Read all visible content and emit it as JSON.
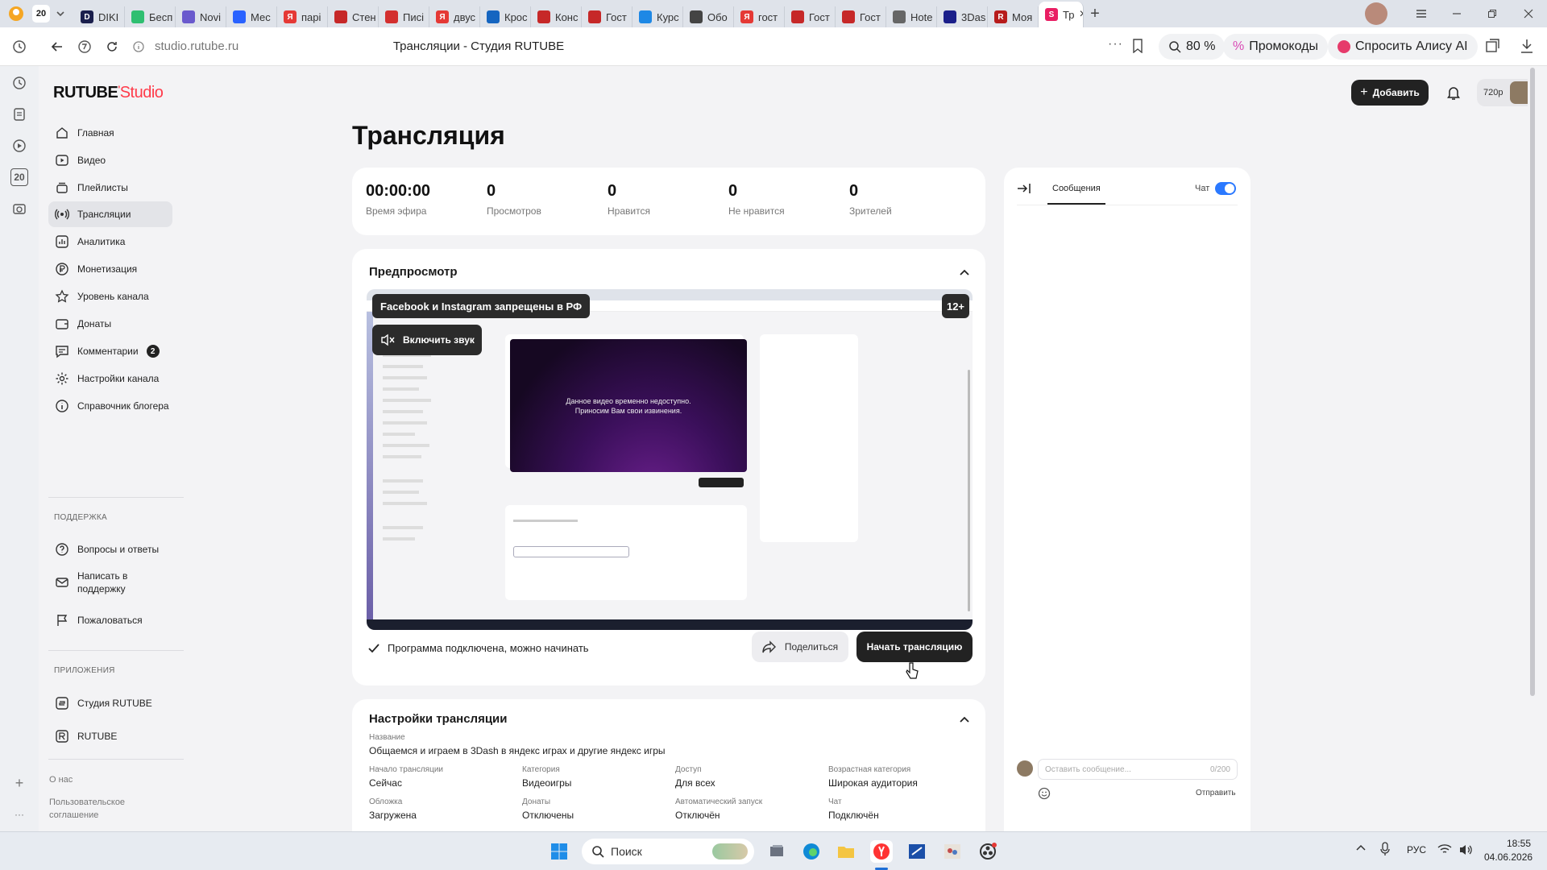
{
  "browser": {
    "tab_counter": "20",
    "tabs": [
      {
        "label": "DIKI",
        "color": "#1b1f4d",
        "letter": "D"
      },
      {
        "label": "Бесп",
        "color": "#2fbf71",
        "letter": ""
      },
      {
        "label": "Novi",
        "color": "#6a5acd",
        "letter": ""
      },
      {
        "label": "Мес",
        "color": "#2962ff",
        "letter": ""
      },
      {
        "label": "парі",
        "color": "#e53935",
        "letter": "Я"
      },
      {
        "label": "Стен",
        "color": "#c62828",
        "letter": ""
      },
      {
        "label": "Писі",
        "color": "#d32f2f",
        "letter": ""
      },
      {
        "label": "двус",
        "color": "#e53935",
        "letter": "Я"
      },
      {
        "label": "Крос",
        "color": "#1565c0",
        "letter": ""
      },
      {
        "label": "Конс",
        "color": "#c62828",
        "letter": ""
      },
      {
        "label": "Гост",
        "color": "#c62828",
        "letter": ""
      },
      {
        "label": "Курс",
        "color": "#1e88e5",
        "letter": ""
      },
      {
        "label": "Обо",
        "color": "#444444",
        "letter": ""
      },
      {
        "label": "гост",
        "color": "#e53935",
        "letter": "Я"
      },
      {
        "label": "Гост",
        "color": "#c62828",
        "letter": ""
      },
      {
        "label": "Гост",
        "color": "#c62828",
        "letter": ""
      },
      {
        "label": "Hote",
        "color": "#666666",
        "letter": ""
      },
      {
        "label": "3Das",
        "color": "#1b1f8a",
        "letter": ""
      },
      {
        "label": "Моя",
        "color": "#b71c1c",
        "letter": "R"
      },
      {
        "label": "Тр",
        "color": "#e91e63",
        "letter": "S"
      }
    ],
    "url": "studio.rutube.ru",
    "page_title": "Трансляции - Студия RUTUBE",
    "zoom": "80 %",
    "promo": "Промокоды",
    "alice": "Спросить Алису AI"
  },
  "header": {
    "logo_main": "RUTUBE",
    "logo_sub": "Studio",
    "add_button": "Добавить",
    "quality": "720p"
  },
  "sidebar": {
    "items": [
      {
        "label": "Главная",
        "icon": "home-icon"
      },
      {
        "label": "Видео",
        "icon": "video-icon"
      },
      {
        "label": "Плейлисты",
        "icon": "playlist-icon"
      },
      {
        "label": "Трансляции",
        "icon": "broadcast-icon"
      },
      {
        "label": "Аналитика",
        "icon": "analytics-icon"
      },
      {
        "label": "Монетизация",
        "icon": "ruble-icon"
      },
      {
        "label": "Уровень канала",
        "icon": "star-icon"
      },
      {
        "label": "Донаты",
        "icon": "wallet-icon"
      },
      {
        "label": "Комментарии",
        "icon": "comment-icon",
        "badge": "2"
      },
      {
        "label": "Настройки канала",
        "icon": "gear-icon"
      },
      {
        "label": "Справочник блогера",
        "icon": "info-icon"
      }
    ],
    "support_heading": "ПОДДЕРЖКА",
    "support_items": [
      {
        "label": "Вопросы и ответы",
        "icon": "question-icon"
      },
      {
        "label": "Написать в поддержку",
        "icon": "mail-icon"
      },
      {
        "label": "Пожаловаться",
        "icon": "flag-icon"
      }
    ],
    "apps_heading": "ПРИЛОЖЕНИЯ",
    "apps_items": [
      {
        "label": "Студия RUTUBE",
        "icon": "studio-app-icon"
      },
      {
        "label": "RUTUBE",
        "icon": "rutube-app-icon"
      }
    ],
    "footer": [
      "О нас",
      "Пользовательское соглашение"
    ]
  },
  "main": {
    "title": "Трансляция",
    "stats": [
      {
        "value": "00:00:00",
        "label": "Время эфира"
      },
      {
        "value": "0",
        "label": "Просмотров"
      },
      {
        "value": "0",
        "label": "Нравится"
      },
      {
        "value": "0",
        "label": "Не нравится"
      },
      {
        "value": "0",
        "label": "Зрителей"
      }
    ],
    "preview": {
      "heading": "Предпросмотр",
      "ban_notice": "Facebook и Instagram запрещены в РФ",
      "age": "12+",
      "unmute": "Включить звук",
      "video_unavailable_1": "Данное видео временно недоступно.",
      "video_unavailable_2": "Приносим Вам свои извинения.",
      "status": "Программа подключена, можно начинать",
      "share": "Поделиться",
      "start": "Начать трансляцию"
    },
    "settings": {
      "heading": "Настройки трансляции",
      "name_label": "Название",
      "name_value": "Общаемся и играем в 3Dash в яндекс играх и другие яндекс игры",
      "fields": [
        {
          "label": "Начало трансляции",
          "value": "Сейчас"
        },
        {
          "label": "Категория",
          "value": "Видеоигры"
        },
        {
          "label": "Доступ",
          "value": "Для всех"
        },
        {
          "label": "Возрастная категория",
          "value": "Широкая аудитория"
        },
        {
          "label": "Обложка",
          "value": "Загружена"
        },
        {
          "label": "Донаты",
          "value": "Отключены"
        },
        {
          "label": "Автоматический запуск",
          "value": "Отключён"
        },
        {
          "label": "Чат",
          "value": "Подключён"
        }
      ]
    }
  },
  "chat": {
    "tab": "Сообщения",
    "toggle_label": "Чат",
    "toggle_on": true,
    "input_placeholder": "Оставить сообщение...",
    "counter": "0/200",
    "send": "Отправить"
  },
  "taskbar": {
    "search": "Поиск",
    "lang": "РУС",
    "time": "18:55",
    "date": "04.06.2026"
  }
}
